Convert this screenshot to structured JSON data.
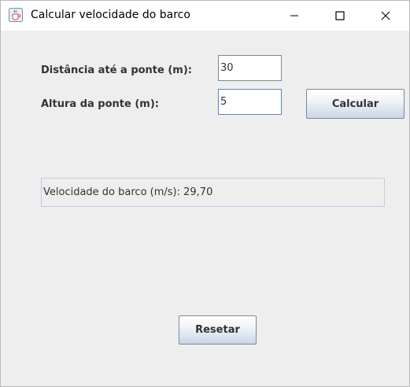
{
  "window": {
    "title": "Calcular velocidade do barco",
    "icon": "java-cup-icon"
  },
  "controls": {
    "minimize_icon": "minimize-icon",
    "maximize_icon": "maximize-icon",
    "close_icon": "close-icon"
  },
  "form": {
    "distance_label": "Distância até a ponte (m):",
    "distance_value": "30",
    "height_label": "Altura da ponte (m):",
    "height_value": "5",
    "calculate_label": "Calcular"
  },
  "result": {
    "text": "Velocidade do barco (m/s): 29,70"
  },
  "reset": {
    "label": "Resetar"
  },
  "colors": {
    "background": "#eeeeee",
    "button_gradient_bottom": "#c9d6e5",
    "border": "#7a8a99",
    "result_border": "#b8cfe5"
  }
}
